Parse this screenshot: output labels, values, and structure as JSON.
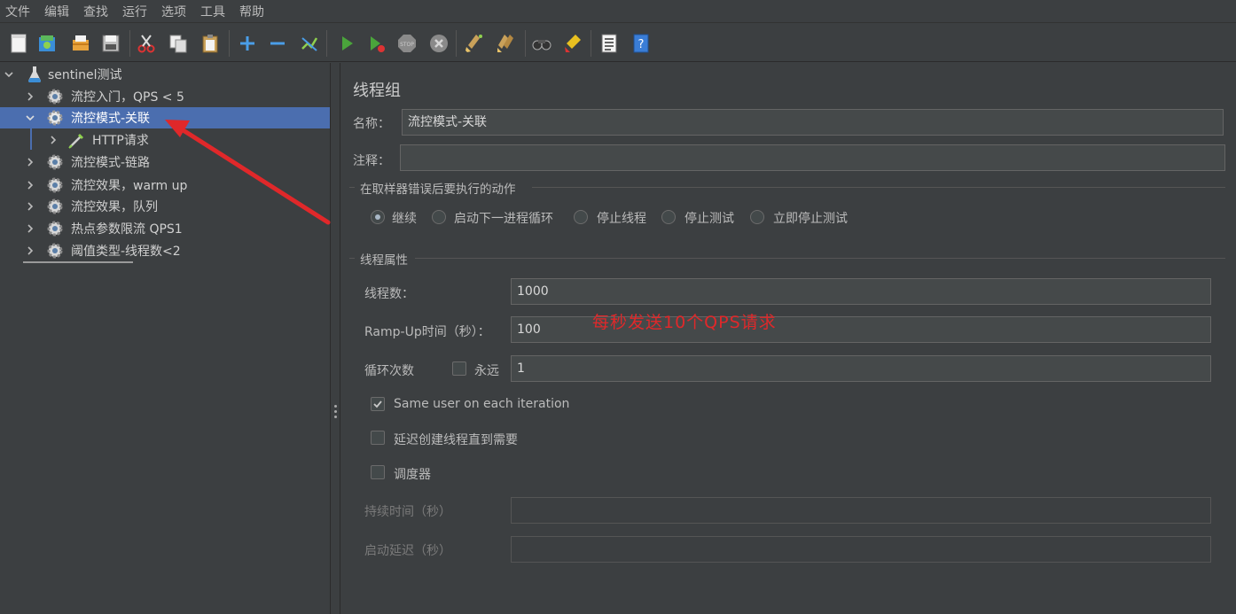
{
  "menu": [
    "文件",
    "编辑",
    "查找",
    "运行",
    "选项",
    "工具",
    "帮助"
  ],
  "toolbar": [
    "new-icon",
    "templates-icon",
    "open-icon",
    "save-icon",
    "cut-icon",
    "copy-icon",
    "paste-icon",
    "expand-icon",
    "collapse-icon",
    "toggle-icon",
    "start-icon",
    "start-no-pause-icon",
    "stop-icon",
    "shutdown-icon",
    "clear-icon",
    "clear-all-icon",
    "search-icon",
    "reset-search-icon",
    "function-helper-icon",
    "help-icon"
  ],
  "tree": {
    "root": "sentinel测试",
    "items": [
      {
        "label": "流控入门，QPS < 5"
      },
      {
        "label": "流控模式-关联",
        "selected": true
      },
      {
        "label": "HTTP请求",
        "child": true
      },
      {
        "label": "流控模式-链路"
      },
      {
        "label": "流控效果，warm up"
      },
      {
        "label": "流控效果，队列"
      },
      {
        "label": "热点参数限流 QPS1"
      },
      {
        "label": "阈值类型-线程数<2"
      }
    ]
  },
  "panel": {
    "title": "线程组",
    "name_label": "名称：",
    "name_value": "流控模式-关联",
    "comment_label": "注释：",
    "comment_value": "",
    "error_action_title": "在取样器错误后要执行的动作",
    "error_actions": [
      {
        "label": "继续",
        "selected": true
      },
      {
        "label": "启动下一进程循环",
        "selected": false
      },
      {
        "label": "停止线程",
        "selected": false
      },
      {
        "label": "停止测试",
        "selected": false
      },
      {
        "label": "立即停止测试",
        "selected": false
      }
    ],
    "thread_props_title": "线程属性",
    "threads_label": "线程数：",
    "threads_value": "1000",
    "rampup_label": "Ramp-Up时间（秒）：",
    "rampup_value": "100",
    "annotation": "每秒发送10个QPS请求",
    "loop_label": "循环次数",
    "forever_label": "永远",
    "forever_checked": false,
    "loop_value": "1",
    "same_user_label": "Same user on each iteration",
    "same_user_checked": true,
    "delay_label": "延迟创建线程直到需要",
    "delay_checked": false,
    "scheduler_label": "调度器",
    "scheduler_checked": false,
    "duration_label": "持续时间（秒）",
    "duration_value": "",
    "startup_delay_label": "启动延迟（秒）",
    "startup_delay_value": ""
  },
  "colors": {
    "background": "#3c3f41",
    "selection": "#4b6eaf",
    "annotation": "#e0282a",
    "run": "#4aa43b"
  }
}
